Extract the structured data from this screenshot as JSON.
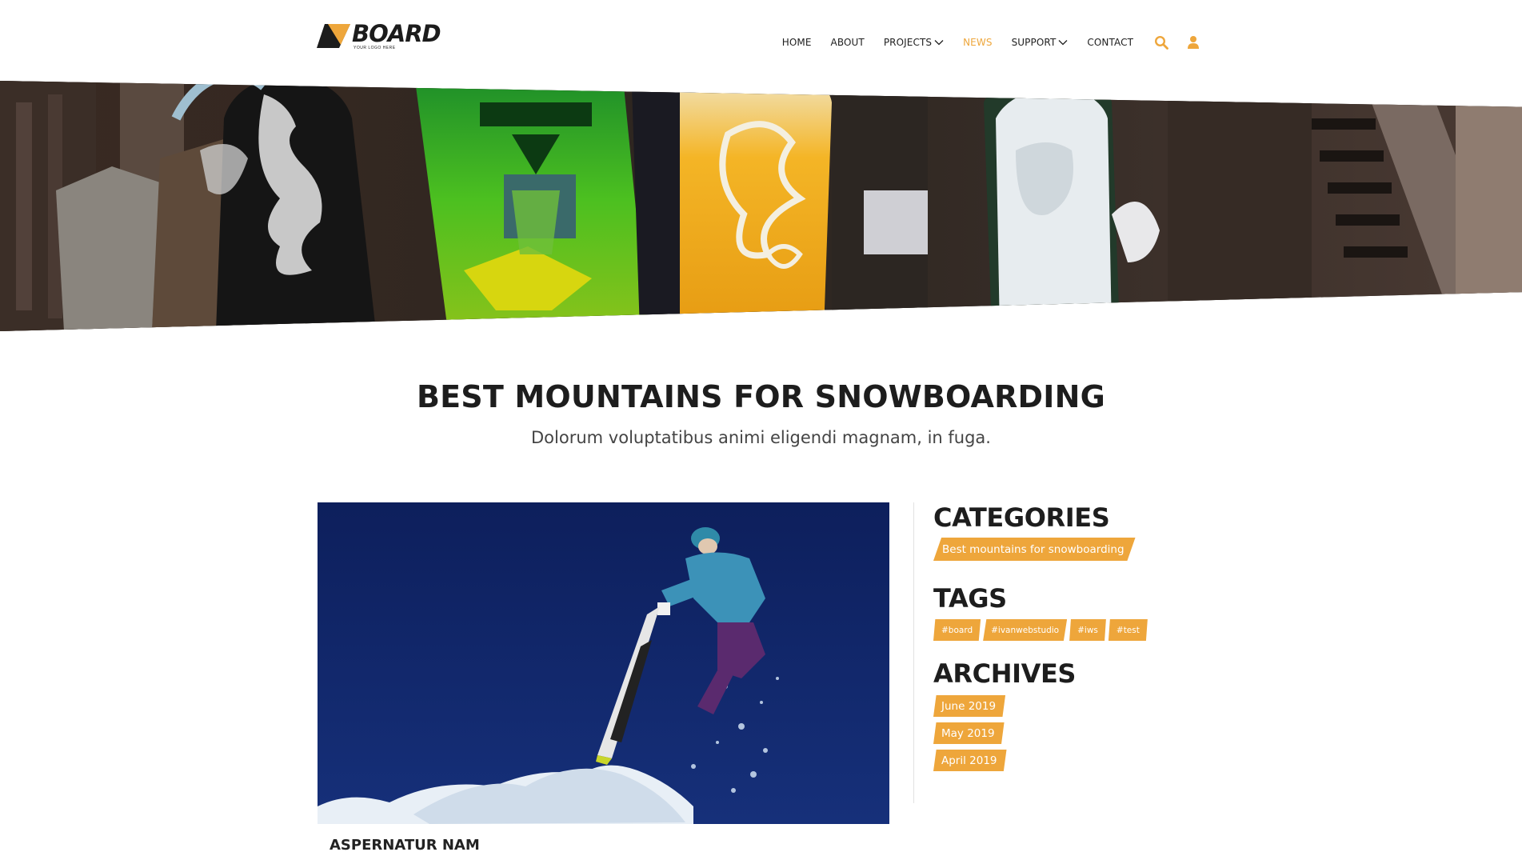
{
  "brand": {
    "name": "BOARD",
    "tagline": "YOUR LOGO HERE",
    "accent_color": "#eea63b",
    "dark_color": "#1d1d1d"
  },
  "nav": {
    "items": [
      {
        "label": "HOME",
        "active": false,
        "dropdown": false
      },
      {
        "label": "ABOUT",
        "active": false,
        "dropdown": false
      },
      {
        "label": "PROJECTS",
        "active": false,
        "dropdown": true
      },
      {
        "label": "NEWS",
        "active": true,
        "dropdown": false
      },
      {
        "label": "SUPPORT",
        "active": false,
        "dropdown": true
      },
      {
        "label": "CONTACT",
        "active": false,
        "dropdown": false
      }
    ],
    "icons": [
      "search-icon",
      "user-icon"
    ]
  },
  "hero": {
    "image": "snowboards-leaning-against-wall"
  },
  "page": {
    "title": "BEST MOUNTAINS FOR SNOWBOARDING",
    "subtitle": "Dolorum voluptatibus animi eligendi magnam, in fuga."
  },
  "post": {
    "image": "snowboarder-jumping-blue-sky",
    "title": "ASPERNATUR NAM"
  },
  "sidebar": {
    "categories": {
      "heading": "CATEGORIES",
      "items": [
        "Best mountains for snowboarding"
      ]
    },
    "tags": {
      "heading": "TAGS",
      "items": [
        "#board",
        "#ivanwebstudio",
        "#iws",
        "#test"
      ]
    },
    "archives": {
      "heading": "ARCHIVES",
      "items": [
        "June 2019",
        "May 2019",
        "April 2019"
      ]
    }
  }
}
